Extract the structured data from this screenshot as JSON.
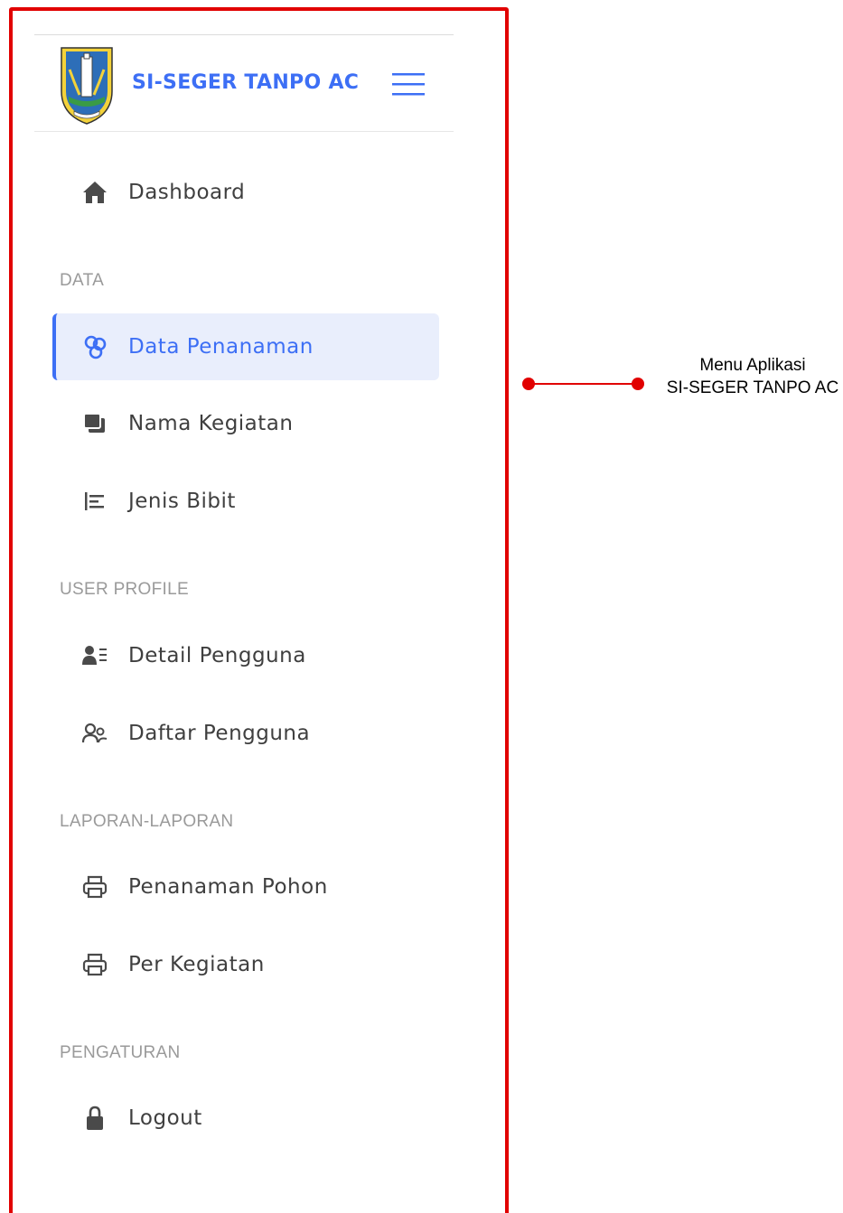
{
  "brand": {
    "title": "SI-SEGER TANPO AC",
    "logo_icon": "east-java-crest-logo",
    "menu_icon": "hamburger-menu-icon",
    "accent_color": "#3d6ff5"
  },
  "nav": {
    "dashboard": {
      "label": "Dashboard",
      "icon": "home-icon"
    },
    "sections": {
      "data": "DATA",
      "user_profile": "USER PROFILE",
      "laporan": "LAPORAN-LAPORAN",
      "pengaturan": "PENGATURAN"
    },
    "data_penanaman": {
      "label": "Data Penanaman",
      "icon": "nodes-icon",
      "active": true
    },
    "nama_kegiatan": {
      "label": "Nama Kegiatan",
      "icon": "stacked-squares-icon"
    },
    "jenis_bibit": {
      "label": "Jenis Bibit",
      "icon": "bar-list-icon"
    },
    "detail_pengguna": {
      "label": "Detail Pengguna",
      "icon": "user-details-icon"
    },
    "daftar_pengguna": {
      "label": "Daftar Pengguna",
      "icon": "users-icon"
    },
    "penanaman_pohon": {
      "label": "Penanaman Pohon",
      "icon": "printer-icon"
    },
    "per_kegiatan": {
      "label": "Per Kegiatan",
      "icon": "printer-icon"
    },
    "logout": {
      "label": "Logout",
      "icon": "lock-icon"
    }
  },
  "annotation": {
    "line1": "Menu Aplikasi",
    "line2": "SI-SEGER TANPO AC",
    "color": "#e10000"
  }
}
